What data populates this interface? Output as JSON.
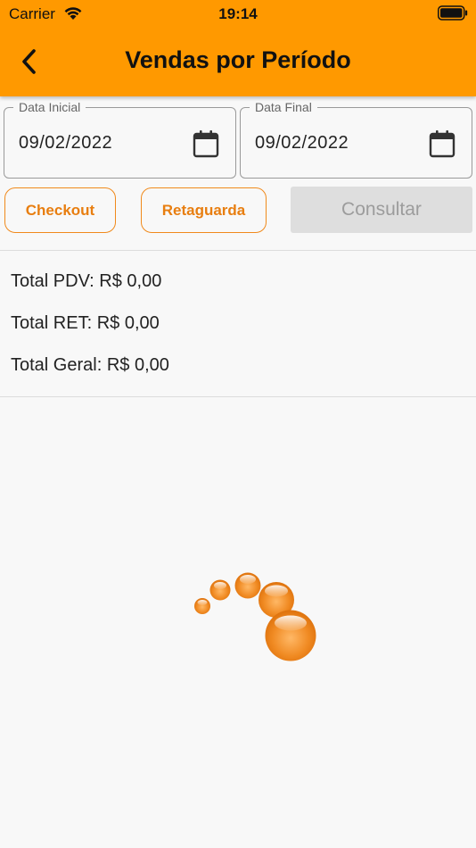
{
  "status_bar": {
    "carrier": "Carrier",
    "time": "19:14"
  },
  "header": {
    "title": "Vendas por Período"
  },
  "dates": {
    "initial": {
      "label": "Data Inicial",
      "value": "09/02/2022"
    },
    "final": {
      "label": "Data Final",
      "value": "09/02/2022"
    }
  },
  "buttons": {
    "checkout": "Checkout",
    "retaguarda": "Retaguarda",
    "consultar": "Consultar"
  },
  "totals": {
    "pdv": "Total PDV: R$ 0,00",
    "ret": "Total RET: R$ 0,00",
    "geral": "Total Geral: R$ 0,00"
  },
  "colors": {
    "accent": "#ff9900",
    "button_outline": "#f08a1c",
    "disabled_bg": "#dedede",
    "disabled_text": "#9c9c9c"
  },
  "icons": {
    "back": "chevron-left-icon",
    "calendar": "calendar-icon",
    "wifi": "wifi-icon",
    "battery": "battery-icon",
    "loader": "loading-spinner-icon"
  }
}
